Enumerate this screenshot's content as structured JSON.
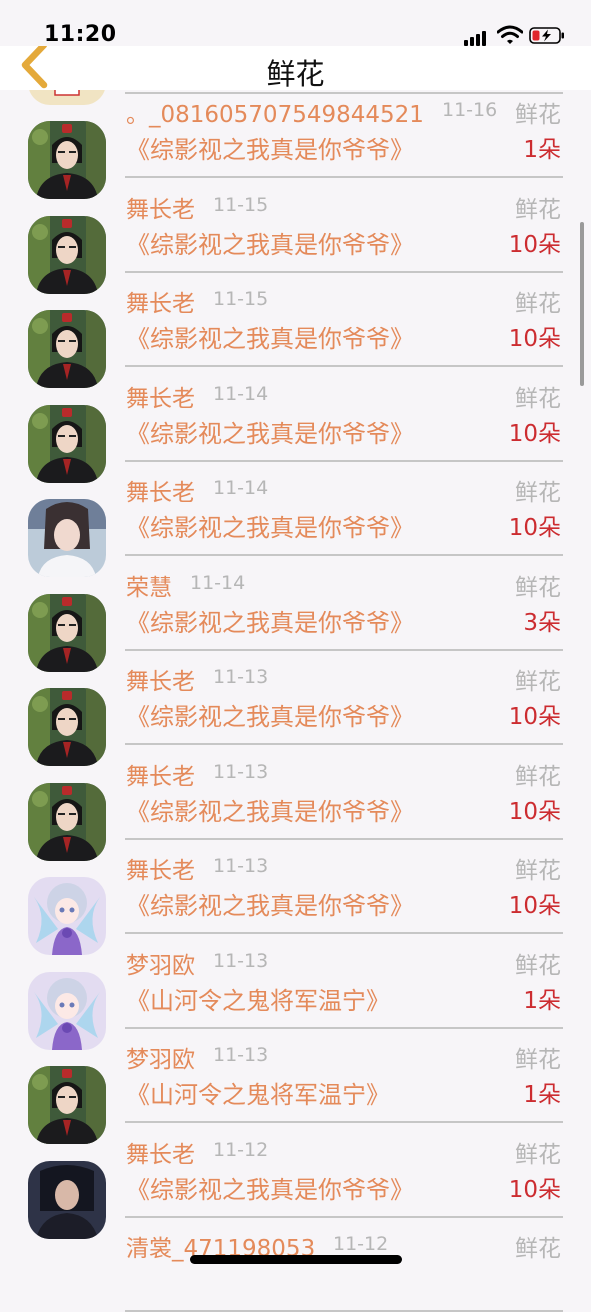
{
  "status_bar": {
    "time": "11:20"
  },
  "nav": {
    "title": "鲜花"
  },
  "colors": {
    "username": "#e48a5a",
    "book": "#e48a5a",
    "quantity": "#cc2c30",
    "meta": "#b6b6b6"
  },
  "rows": [
    {
      "user": "",
      "date": "",
      "type": "",
      "book": "",
      "qty": "",
      "avatar": "partial"
    },
    {
      "user": "。_081605707549844521",
      "date": "11-16",
      "type": "鲜花",
      "book": "《综影视之我真是你爷爷》",
      "qty": "1朵",
      "avatar": "cartoon-girl"
    },
    {
      "user": "舞长老",
      "date": "11-15",
      "type": "鲜花",
      "book": "《综影视之我真是你爷爷》",
      "qty": "10朵",
      "avatar": "costume-man"
    },
    {
      "user": "舞长老",
      "date": "11-15",
      "type": "鲜花",
      "book": "《综影视之我真是你爷爷》",
      "qty": "10朵",
      "avatar": "costume-man"
    },
    {
      "user": "舞长老",
      "date": "11-14",
      "type": "鲜花",
      "book": "《综影视之我真是你爷爷》",
      "qty": "10朵",
      "avatar": "costume-man"
    },
    {
      "user": "舞长老",
      "date": "11-14",
      "type": "鲜花",
      "book": "《综影视之我真是你爷爷》",
      "qty": "10朵",
      "avatar": "costume-man"
    },
    {
      "user": "荣慧",
      "date": "11-14",
      "type": "鲜花",
      "book": "《综影视之我真是你爷爷》",
      "qty": "3朵",
      "avatar": "white-robe"
    },
    {
      "user": "舞长老",
      "date": "11-13",
      "type": "鲜花",
      "book": "《综影视之我真是你爷爷》",
      "qty": "10朵",
      "avatar": "costume-man"
    },
    {
      "user": "舞长老",
      "date": "11-13",
      "type": "鲜花",
      "book": "《综影视之我真是你爷爷》",
      "qty": "10朵",
      "avatar": "costume-man"
    },
    {
      "user": "舞长老",
      "date": "11-13",
      "type": "鲜花",
      "book": "《综影视之我真是你爷爷》",
      "qty": "10朵",
      "avatar": "costume-man"
    },
    {
      "user": "梦羽欧",
      "date": "11-13",
      "type": "鲜花",
      "book": "《山河令之鬼将军温宁》",
      "qty": "1朵",
      "avatar": "anime-fairy"
    },
    {
      "user": "梦羽欧",
      "date": "11-13",
      "type": "鲜花",
      "book": "《山河令之鬼将军温宁》",
      "qty": "1朵",
      "avatar": "anime-fairy"
    },
    {
      "user": "舞长老",
      "date": "11-12",
      "type": "鲜花",
      "book": "《综影视之我真是你爷爷》",
      "qty": "10朵",
      "avatar": "costume-man"
    },
    {
      "user": "清裳_471198053",
      "date": "11-12",
      "type": "鲜花",
      "book": "",
      "qty": "",
      "avatar": "dark-warrior"
    }
  ]
}
